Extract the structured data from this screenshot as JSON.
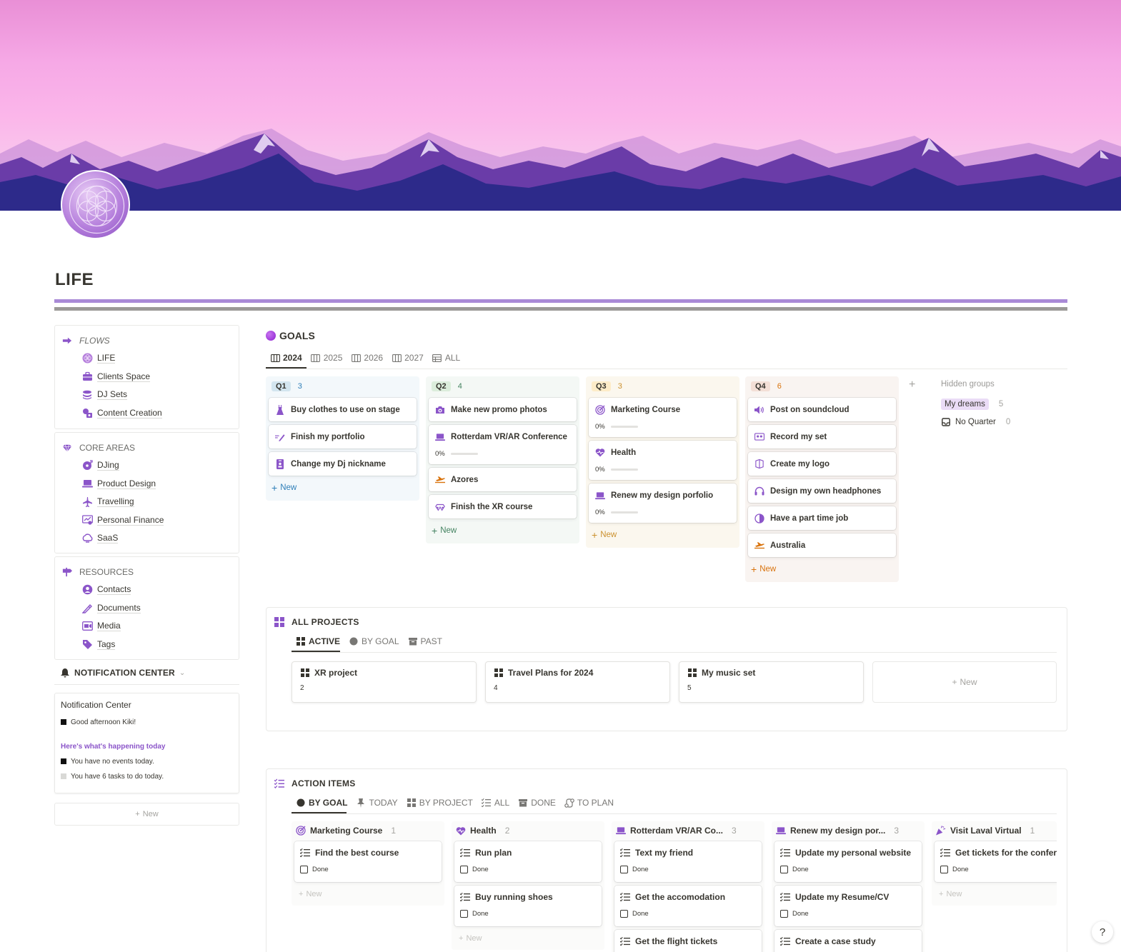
{
  "page": {
    "title": "LIFE"
  },
  "sidebar": {
    "flows": {
      "heading": "FLOWS",
      "items": [
        {
          "label": "LIFE",
          "icon": "flower-of-life-icon"
        },
        {
          "label": "Clients Space",
          "icon": "briefcase-icon"
        },
        {
          "label": "DJ Sets",
          "icon": "stack-icon"
        },
        {
          "label": "Content Creation",
          "icon": "content-icon"
        }
      ]
    },
    "core": {
      "heading": "CORE AREAS",
      "items": [
        {
          "label": "DJing",
          "icon": "dj-icon"
        },
        {
          "label": "Product Design",
          "icon": "laptop-icon"
        },
        {
          "label": "Travelling",
          "icon": "plane-icon"
        },
        {
          "label": "Personal Finance",
          "icon": "finance-icon"
        },
        {
          "label": "SaaS",
          "icon": "saas-icon"
        }
      ]
    },
    "resources": {
      "heading": "RESOURCES",
      "items": [
        {
          "label": "Contacts",
          "icon": "contacts-icon"
        },
        {
          "label": "Documents",
          "icon": "documents-icon"
        },
        {
          "label": "Media",
          "icon": "media-icon"
        },
        {
          "label": "Tags",
          "icon": "tags-icon"
        }
      ]
    },
    "notification": {
      "heading": "NOTIFICATION CENTER",
      "box_title": "Notification Center",
      "greeting": "Good afternoon Kiki!",
      "subheading": "Here's what's happening today",
      "events": "You have no events today.",
      "tasks": "You have 6 tasks to do today."
    },
    "new_label": "New"
  },
  "goals": {
    "heading": "GOALS",
    "tabs": [
      "2024",
      "2025",
      "2026",
      "2027",
      "ALL"
    ],
    "columns": [
      {
        "label": "Q1",
        "count": "3",
        "cards": [
          {
            "title": "Buy clothes to use on stage",
            "icon": "dress-icon"
          },
          {
            "title": "Finish my portfolio",
            "icon": "pencil-icon"
          },
          {
            "title": "Change my Dj nickname",
            "icon": "id-badge-icon"
          }
        ]
      },
      {
        "label": "Q2",
        "count": "4",
        "cards": [
          {
            "title": "Make new promo photos",
            "icon": "camera-icon"
          },
          {
            "title": "Rotterdam VR/AR Conference",
            "icon": "laptop-icon",
            "progress": "0%"
          },
          {
            "title": "Azores",
            "icon": "plane-icon"
          },
          {
            "title": "Finish the XR course",
            "icon": "vr-icon"
          }
        ]
      },
      {
        "label": "Q3",
        "count": "3",
        "cards": [
          {
            "title": "Marketing Course",
            "icon": "target-icon",
            "progress": "0%"
          },
          {
            "title": "Health",
            "icon": "heart-icon",
            "progress": "0%"
          },
          {
            "title": "Renew my design porfolio",
            "icon": "laptop-icon",
            "progress": "0%"
          }
        ]
      },
      {
        "label": "Q4",
        "count": "6",
        "cards": [
          {
            "title": "Post on soundcloud",
            "icon": "speaker-icon"
          },
          {
            "title": "Record my set",
            "icon": "tape-icon"
          },
          {
            "title": "Create my logo",
            "icon": "logo-icon"
          },
          {
            "title": "Design my own headphones",
            "icon": "headphones-icon"
          },
          {
            "title": "Have a part time job",
            "icon": "half-circle-icon"
          },
          {
            "title": "Australia",
            "icon": "plane-icon"
          }
        ]
      }
    ],
    "new_label": "New",
    "hidden_groups": {
      "heading": "Hidden groups",
      "items": [
        {
          "label": "My dreams",
          "count": "5"
        },
        {
          "label": "No Quarter",
          "count": "0"
        }
      ]
    }
  },
  "projects": {
    "heading": "ALL PROJECTS",
    "tabs": [
      "ACTIVE",
      "BY GOAL",
      "PAST"
    ],
    "cards": [
      {
        "title": "XR project",
        "count": "2"
      },
      {
        "title": "Travel Plans for 2024",
        "count": "4"
      },
      {
        "title": "My music set",
        "count": "5"
      }
    ],
    "new_label": "New"
  },
  "actions": {
    "heading": "ACTION ITEMS",
    "tabs": [
      "BY GOAL",
      "TODAY",
      "BY PROJECT",
      "ALL",
      "DONE",
      "TO PLAN"
    ],
    "done_label": "Done",
    "new_label": "New",
    "columns": [
      {
        "label": "Marketing Course",
        "count": "1",
        "icon": "target-icon",
        "cards": [
          "Find the best course"
        ]
      },
      {
        "label": "Health",
        "count": "2",
        "icon": "heart-icon",
        "cards": [
          "Run plan",
          "Buy running shoes"
        ]
      },
      {
        "label": "Rotterdam VR/AR Co...",
        "count": "3",
        "icon": "laptop-icon",
        "cards": [
          "Text my friend",
          "Get the accomodation",
          "Get the flight tickets"
        ]
      },
      {
        "label": "Renew my design por...",
        "count": "3",
        "icon": "laptop-icon",
        "cards": [
          "Update my personal website",
          "Update my Resume/CV",
          "Create a case study"
        ]
      },
      {
        "label": "Visit Laval Virtual",
        "count": "1",
        "icon": "party-icon",
        "cards": [
          "Get tickets for the conference"
        ]
      }
    ]
  },
  "colors": {
    "accent": "#8b55c9",
    "q1": "#2f7fb8",
    "q2": "#448361",
    "q3": "#cb912f",
    "q4": "#d9730d"
  },
  "help": "?"
}
